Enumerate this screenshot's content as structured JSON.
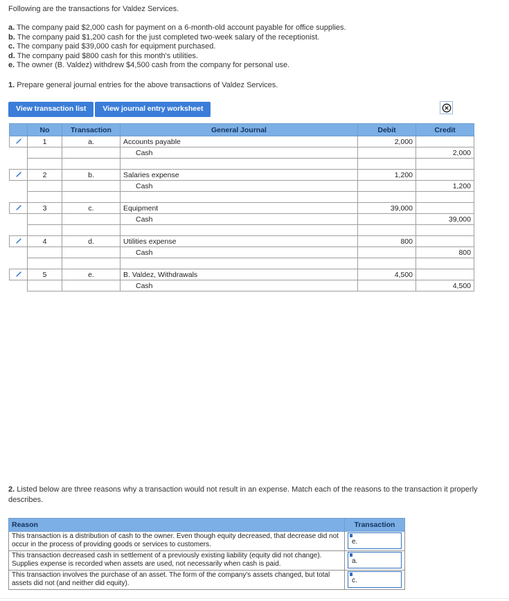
{
  "intro": {
    "lead": "Following are the transactions for Valdez Services.",
    "transactions": [
      {
        "label": "a.",
        "text": "The company paid $2,000 cash for payment on a 6-month-old account payable for office supplies."
      },
      {
        "label": "b.",
        "text": "The company paid $1,200 cash for the just completed two-week salary of the receptionist."
      },
      {
        "label": "c.",
        "text": "The company paid $39,000 cash for equipment purchased."
      },
      {
        "label": "d.",
        "text": "The company paid $800 cash for this month's utilities."
      },
      {
        "label": "e.",
        "text": "The owner (B. Valdez) withdrew $4,500 cash from the company for personal use."
      }
    ],
    "requirement1_number": "1.",
    "requirement1_text": "Prepare general journal entries for the above transactions of Valdez Services."
  },
  "toolbar": {
    "tab_transaction_list": "View transaction list",
    "tab_journal_worksheet": "View journal entry worksheet",
    "close_icon": "close-circle-icon"
  },
  "journal": {
    "headers": {
      "no": "No",
      "transaction": "Transaction",
      "general_journal": "General Journal",
      "debit": "Debit",
      "credit": "Credit"
    },
    "entries": [
      {
        "no": "1",
        "transaction": "a.",
        "lines": [
          {
            "account": "Accounts payable",
            "indent": false,
            "debit": "2,000",
            "credit": ""
          },
          {
            "account": "Cash",
            "indent": true,
            "debit": "",
            "credit": "2,000"
          }
        ]
      },
      {
        "no": "2",
        "transaction": "b.",
        "lines": [
          {
            "account": "Salaries expense",
            "indent": false,
            "debit": "1,200",
            "credit": ""
          },
          {
            "account": "Cash",
            "indent": true,
            "debit": "",
            "credit": "1,200"
          }
        ]
      },
      {
        "no": "3",
        "transaction": "c.",
        "lines": [
          {
            "account": "Equipment",
            "indent": false,
            "debit": "39,000",
            "credit": ""
          },
          {
            "account": "Cash",
            "indent": true,
            "debit": "",
            "credit": "39,000"
          }
        ]
      },
      {
        "no": "4",
        "transaction": "d.",
        "lines": [
          {
            "account": "Utilities expense",
            "indent": false,
            "debit": "800",
            "credit": ""
          },
          {
            "account": "Cash",
            "indent": true,
            "debit": "",
            "credit": "800"
          }
        ]
      },
      {
        "no": "5",
        "transaction": "e.",
        "lines": [
          {
            "account": "B. Valdez, Withdrawals",
            "indent": false,
            "debit": "4,500",
            "credit": ""
          },
          {
            "account": "Cash",
            "indent": true,
            "debit": "",
            "credit": "4,500"
          }
        ]
      }
    ],
    "row_edit_icon": "pencil-icon"
  },
  "question2": {
    "number": "2.",
    "text": "Listed below are three reasons why a transaction would not result in an expense.  Match each of the reasons to the transaction it properly describes."
  },
  "reason_table": {
    "headers": {
      "reason": "Reason",
      "transaction": "Transaction"
    },
    "rows": [
      {
        "reason": "This transaction is a distribution of cash to the owner. Even though equity decreased, that decrease did not occur in the process of providing goods or services to customers.",
        "transaction": "e."
      },
      {
        "reason": "This transaction decreased cash in settlement of a previously existing liability (equity did not change). Supplies expense is recorded when assets are used, not necessarily when cash is paid.",
        "transaction": "a."
      },
      {
        "reason": "This transaction involves the purchase of an asset. The form of the company's assets changed, but total assets did not (and neither did equity).",
        "transaction": "c."
      }
    ]
  },
  "colors": {
    "button_blue": "#3b7dd8",
    "header_blue": "#7cafe6",
    "border_gray": "#9e9e9e",
    "input_border_blue": "#2f6fc0"
  }
}
